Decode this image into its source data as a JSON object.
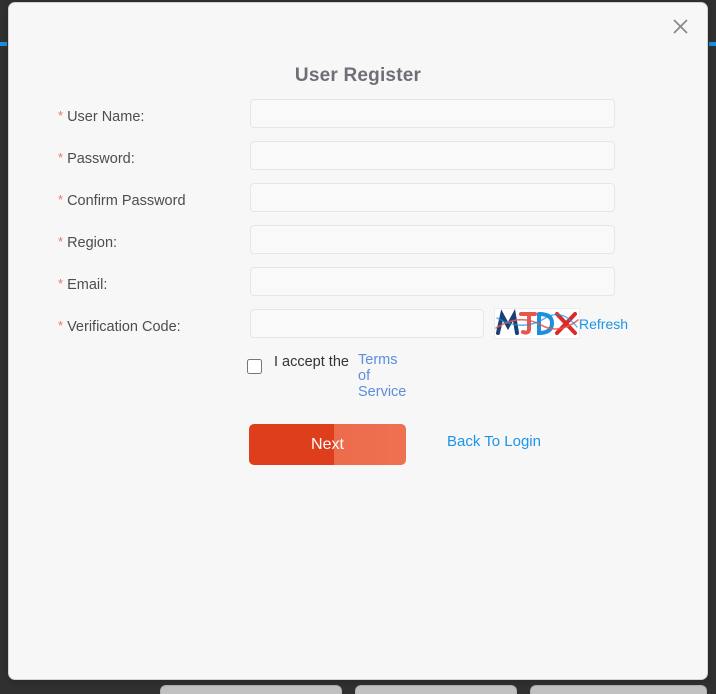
{
  "dialog": {
    "title": "User Register",
    "close_icon": "close-icon"
  },
  "form": {
    "required_marker": "*",
    "fields": [
      {
        "label": "User Name:",
        "value": "",
        "placeholder": ""
      },
      {
        "label": "Password:",
        "value": "",
        "placeholder": ""
      },
      {
        "label": "Confirm Password",
        "value": "",
        "placeholder": ""
      },
      {
        "label": "Region:",
        "value": "",
        "placeholder": ""
      },
      {
        "label": "Email:",
        "value": "",
        "placeholder": ""
      },
      {
        "label": "Verification Code:",
        "value": "",
        "placeholder": ""
      }
    ],
    "captcha": {
      "text": "MJDX",
      "refresh_label": "Refresh",
      "colors": [
        "#1d3f77",
        "#e8554f",
        "#1b8fe0",
        "#d92b2b"
      ]
    }
  },
  "terms": {
    "accept_label": "I accept the",
    "link_label": "Terms of Service",
    "checked": false
  },
  "actions": {
    "submit_label": "Next",
    "back_label": "Back To Login"
  },
  "colors": {
    "accent_red": "#de3e1c",
    "link_blue": "#1b95e8",
    "terms_blue": "#5b8edc",
    "required_red": "#e8736b",
    "title_gray": "#6f6f78"
  }
}
